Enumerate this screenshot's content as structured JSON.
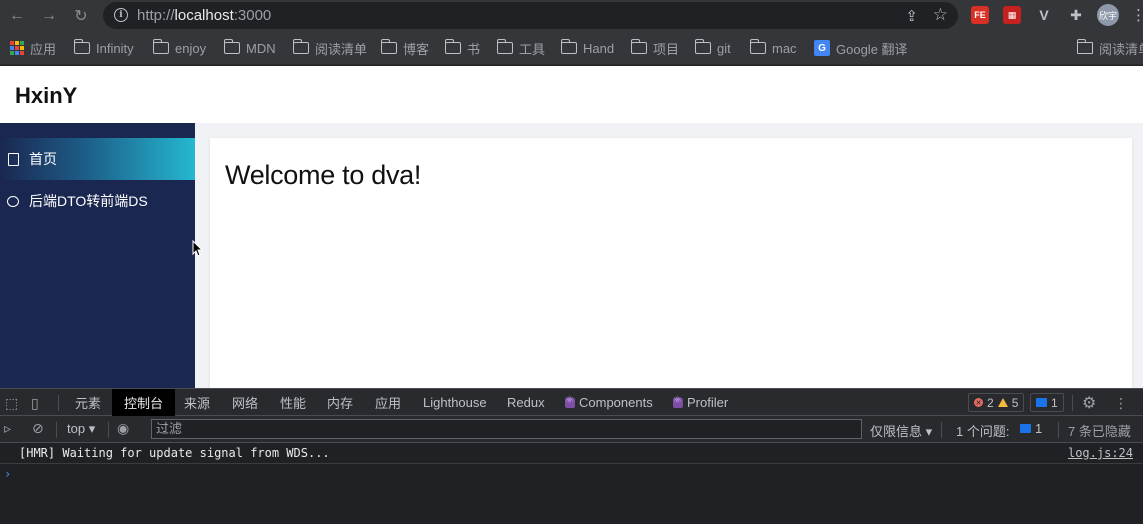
{
  "browser": {
    "url_prefix": "http://",
    "url_host": "localhost",
    "url_port": ":3000",
    "avatar_label": "欣宇",
    "extensions": [
      {
        "name": "fe-extension",
        "label": "FE",
        "color": "#d93025"
      },
      {
        "name": "image-extension",
        "label": "▦",
        "color": "#c5221f"
      },
      {
        "name": "vue-devtools",
        "label": "V",
        "color": "#5f6368"
      }
    ]
  },
  "bookmarks": {
    "items": [
      {
        "name": "apps",
        "label": "应用"
      },
      {
        "name": "infinity",
        "label": "Infinity"
      },
      {
        "name": "enjoy",
        "label": "enjoy"
      },
      {
        "name": "mdn",
        "label": "MDN"
      },
      {
        "name": "reading-list-folder",
        "label": "阅读清单"
      },
      {
        "name": "blog",
        "label": "博客"
      },
      {
        "name": "book",
        "label": "书"
      },
      {
        "name": "tools",
        "label": "工具"
      },
      {
        "name": "hand",
        "label": "Hand"
      },
      {
        "name": "project",
        "label": "项目"
      },
      {
        "name": "git",
        "label": "git"
      },
      {
        "name": "mac",
        "label": "mac"
      },
      {
        "name": "google-translate",
        "label": "Google 翻译"
      }
    ],
    "reading_list": "阅读清单"
  },
  "app": {
    "brand": "HxinY",
    "menu": [
      {
        "label": "首页",
        "active": true
      },
      {
        "label": "后端DTO转前端DS",
        "active": false
      }
    ],
    "welcome": "Welcome to dva!"
  },
  "devtools": {
    "tabs": [
      "元素",
      "控制台",
      "来源",
      "网络",
      "性能",
      "内存",
      "应用",
      "Lighthouse",
      "Redux",
      "Components",
      "Profiler"
    ],
    "active_tab": "控制台",
    "errors": "2",
    "warnings": "5",
    "messages": "1",
    "context": "top",
    "filter_placeholder": "过滤",
    "levels": "仅限信息",
    "issues_label": "1 个问题:",
    "issues_count": "1",
    "hidden": "7 条已隐藏",
    "log": {
      "text": "[HMR] Waiting for update signal from WDS...",
      "source": "log.js:24"
    },
    "prompt": "›"
  }
}
